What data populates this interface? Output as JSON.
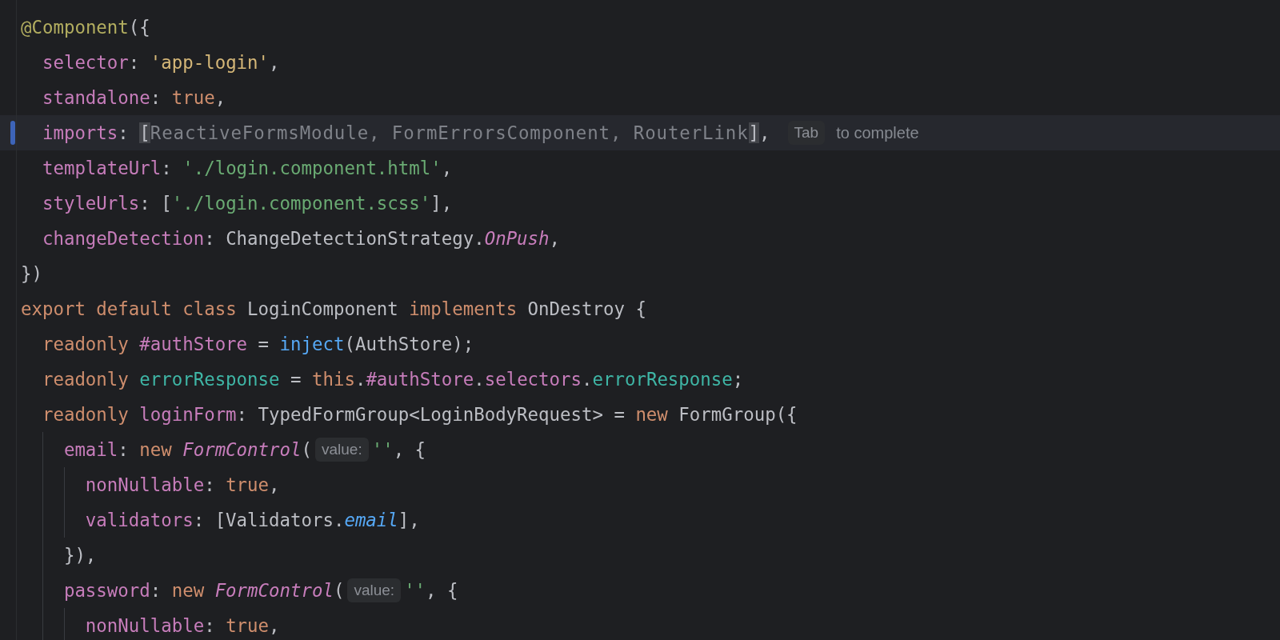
{
  "editor": {
    "lines": [
      {
        "current": false,
        "modified": false,
        "segments": [
          {
            "kind": "code",
            "tokens": [
              {
                "kind": "annotation",
                "text": "@Component"
              },
              {
                "kind": "plain",
                "text": "({"
              }
            ]
          }
        ],
        "children": [
          {
            "current": false,
            "modified": false,
            "segments": [
              {
                "kind": "code",
                "tokens": [
                  {
                    "kind": "prop",
                    "text": "selector"
                  },
                  {
                    "kind": "plain",
                    "text": ": "
                  },
                  {
                    "kind": "string_y",
                    "text": "'app-login'"
                  },
                  {
                    "kind": "plain",
                    "text": ","
                  }
                ]
              }
            ]
          },
          {
            "current": false,
            "modified": false,
            "segments": [
              {
                "kind": "code",
                "tokens": [
                  {
                    "kind": "prop",
                    "text": "standalone"
                  },
                  {
                    "kind": "plain",
                    "text": ": "
                  },
                  {
                    "kind": "keyword",
                    "text": "true"
                  },
                  {
                    "kind": "plain",
                    "text": ","
                  }
                ]
              }
            ]
          },
          {
            "current": true,
            "modified": true,
            "segments": [
              {
                "kind": "code",
                "tokens": [
                  {
                    "kind": "prop",
                    "text": "imports"
                  },
                  {
                    "kind": "plain",
                    "text": ": "
                  },
                  {
                    "kind": "match",
                    "text": "["
                  },
                  {
                    "kind": "ghost",
                    "text": "ReactiveFormsModule, FormErrorsComponent, RouterLink"
                  },
                  {
                    "kind": "match",
                    "text": "]"
                  },
                  {
                    "kind": "plain",
                    "text": ","
                  }
                ]
              },
              {
                "kind": "key_hint",
                "text": "Tab"
              },
              {
                "kind": "completion_hint",
                "text": "to complete"
              }
            ]
          },
          {
            "current": false,
            "modified": false,
            "segments": [
              {
                "kind": "code",
                "tokens": [
                  {
                    "kind": "prop",
                    "text": "templateUrl"
                  },
                  {
                    "kind": "plain",
                    "text": ": "
                  },
                  {
                    "kind": "string",
                    "text": "'./login.component.html'"
                  },
                  {
                    "kind": "plain",
                    "text": ","
                  }
                ]
              }
            ]
          },
          {
            "current": false,
            "modified": false,
            "segments": [
              {
                "kind": "code",
                "tokens": [
                  {
                    "kind": "prop",
                    "text": "styleUrls"
                  },
                  {
                    "kind": "plain",
                    "text": ": ["
                  },
                  {
                    "kind": "string",
                    "text": "'./login.component.scss'"
                  },
                  {
                    "kind": "plain",
                    "text": "],"
                  }
                ]
              }
            ]
          },
          {
            "current": false,
            "modified": false,
            "segments": [
              {
                "kind": "code",
                "tokens": [
                  {
                    "kind": "prop",
                    "text": "changeDetection"
                  },
                  {
                    "kind": "plain",
                    "text": ": ChangeDetectionStrategy."
                  },
                  {
                    "kind": "italic_prop",
                    "text": "OnPush"
                  },
                  {
                    "kind": "plain",
                    "text": ","
                  }
                ]
              }
            ]
          }
        ]
      },
      {
        "current": false,
        "modified": false,
        "segments": [
          {
            "kind": "code",
            "tokens": [
              {
                "kind": "plain",
                "text": "})"
              }
            ]
          }
        ]
      },
      {
        "current": false,
        "modified": false,
        "segments": [
          {
            "kind": "code",
            "tokens": [
              {
                "kind": "keyword",
                "text": "export default class "
              },
              {
                "kind": "plain",
                "text": "LoginComponent "
              },
              {
                "kind": "keyword",
                "text": "implements "
              },
              {
                "kind": "plain",
                "text": "OnDestroy {"
              }
            ]
          }
        ],
        "children": [
          {
            "current": false,
            "modified": false,
            "segments": [
              {
                "kind": "code",
                "tokens": [
                  {
                    "kind": "keyword",
                    "text": "readonly "
                  },
                  {
                    "kind": "prop",
                    "text": "#authStore"
                  },
                  {
                    "kind": "plain",
                    "text": " = "
                  },
                  {
                    "kind": "fn",
                    "text": "inject"
                  },
                  {
                    "kind": "plain",
                    "text": "(AuthStore);"
                  }
                ]
              }
            ]
          },
          {
            "current": false,
            "modified": false,
            "segments": [
              {
                "kind": "code",
                "tokens": [
                  {
                    "kind": "keyword",
                    "text": "readonly "
                  },
                  {
                    "kind": "field",
                    "text": "errorResponse"
                  },
                  {
                    "kind": "plain",
                    "text": " = "
                  },
                  {
                    "kind": "keyword",
                    "text": "this"
                  },
                  {
                    "kind": "plain",
                    "text": "."
                  },
                  {
                    "kind": "prop",
                    "text": "#authStore"
                  },
                  {
                    "kind": "plain",
                    "text": "."
                  },
                  {
                    "kind": "prop",
                    "text": "selectors"
                  },
                  {
                    "kind": "plain",
                    "text": "."
                  },
                  {
                    "kind": "field",
                    "text": "errorResponse"
                  },
                  {
                    "kind": "plain",
                    "text": ";"
                  }
                ]
              }
            ]
          },
          {
            "current": false,
            "modified": false,
            "segments": [
              {
                "kind": "code",
                "tokens": [
                  {
                    "kind": "keyword",
                    "text": "readonly "
                  },
                  {
                    "kind": "prop",
                    "text": "loginForm"
                  },
                  {
                    "kind": "plain",
                    "text": ": TypedFormGroup<LoginBodyRequest> = "
                  },
                  {
                    "kind": "keyword",
                    "text": "new "
                  },
                  {
                    "kind": "plain",
                    "text": "FormGroup({"
                  }
                ]
              }
            ],
            "children": [
              {
                "current": false,
                "modified": false,
                "segments": [
                  {
                    "kind": "code",
                    "tokens": [
                      {
                        "kind": "prop",
                        "text": "email"
                      },
                      {
                        "kind": "plain",
                        "text": ": "
                      },
                      {
                        "kind": "keyword",
                        "text": "new "
                      },
                      {
                        "kind": "italic_prop",
                        "text": "FormControl"
                      },
                      {
                        "kind": "plain",
                        "text": "("
                      }
                    ]
                  },
                  {
                    "kind": "inlay_hint",
                    "text": "value:"
                  },
                  {
                    "kind": "code",
                    "tokens": [
                      {
                        "kind": "string",
                        "text": "''"
                      },
                      {
                        "kind": "plain",
                        "text": ", {"
                      }
                    ]
                  }
                ],
                "children": [
                  {
                    "current": false,
                    "modified": false,
                    "segments": [
                      {
                        "kind": "code",
                        "tokens": [
                          {
                            "kind": "prop",
                            "text": "nonNullable"
                          },
                          {
                            "kind": "plain",
                            "text": ": "
                          },
                          {
                            "kind": "keyword",
                            "text": "true"
                          },
                          {
                            "kind": "plain",
                            "text": ","
                          }
                        ]
                      }
                    ]
                  },
                  {
                    "current": false,
                    "modified": false,
                    "segments": [
                      {
                        "kind": "code",
                        "tokens": [
                          {
                            "kind": "prop",
                            "text": "validators"
                          },
                          {
                            "kind": "plain",
                            "text": ": [Validators."
                          },
                          {
                            "kind": "italic_fn",
                            "text": "email"
                          },
                          {
                            "kind": "plain",
                            "text": "],"
                          }
                        ]
                      }
                    ]
                  }
                ]
              },
              {
                "current": false,
                "modified": false,
                "segments": [
                  {
                    "kind": "code",
                    "tokens": [
                      {
                        "kind": "plain",
                        "text": "}),"
                      }
                    ]
                  }
                ]
              },
              {
                "current": false,
                "modified": false,
                "segments": [
                  {
                    "kind": "code",
                    "tokens": [
                      {
                        "kind": "prop",
                        "text": "password"
                      },
                      {
                        "kind": "plain",
                        "text": ": "
                      },
                      {
                        "kind": "keyword",
                        "text": "new "
                      },
                      {
                        "kind": "italic_prop",
                        "text": "FormControl"
                      },
                      {
                        "kind": "plain",
                        "text": "("
                      }
                    ]
                  },
                  {
                    "kind": "inlay_hint",
                    "text": "value:"
                  },
                  {
                    "kind": "code",
                    "tokens": [
                      {
                        "kind": "string",
                        "text": "''"
                      },
                      {
                        "kind": "plain",
                        "text": ", {"
                      }
                    ]
                  }
                ],
                "children": [
                  {
                    "current": false,
                    "modified": false,
                    "segments": [
                      {
                        "kind": "code",
                        "tokens": [
                          {
                            "kind": "prop",
                            "text": "nonNullable"
                          },
                          {
                            "kind": "plain",
                            "text": ": "
                          },
                          {
                            "kind": "keyword",
                            "text": "true"
                          },
                          {
                            "kind": "plain",
                            "text": ","
                          }
                        ]
                      }
                    ]
                  }
                ]
              }
            ]
          }
        ]
      }
    ]
  }
}
